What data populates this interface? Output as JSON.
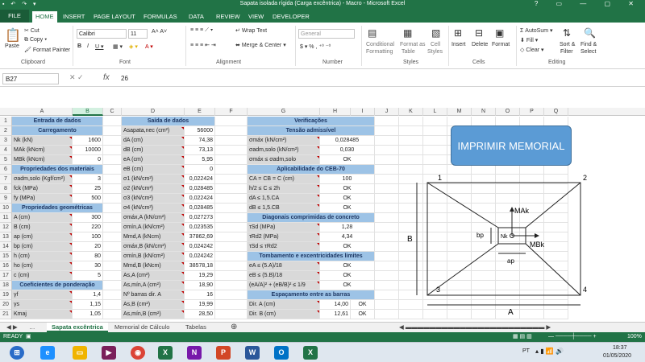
{
  "window": {
    "title": "Sapata isolada rígida (Carga excêntrica) - Macro - Microsoft Excel",
    "controls": "? ▭ — ▢ ✕"
  },
  "tabs": {
    "file": "FILE",
    "items": [
      "HOME",
      "INSERT",
      "PAGE LAYOUT",
      "FORMULAS",
      "DATA",
      "REVIEW",
      "VIEW",
      "DEVELOPER"
    ]
  },
  "ribbon": {
    "paste": "Paste",
    "cut": "Cut",
    "copy": "Copy",
    "format_painter": "Format Painter",
    "font": "Calibri",
    "size": "11",
    "wrap": "Wrap Text",
    "merge": "Merge & Center",
    "general": "General",
    "cond": "Conditional",
    "cond2": "Formatting",
    "fmt_table": "Format as",
    "fmt_table2": "Table",
    "cell_styles": "Cell",
    "cell_styles2": "Styles",
    "insert": "Insert",
    "delete": "Delete",
    "format": "Format",
    "autosum": "AutoSum",
    "fill": "Fill",
    "clear": "Clear",
    "sort": "Sort &",
    "sort2": "Filter",
    "find": "Find &",
    "find2": "Select",
    "groups": [
      "Clipboard",
      "Font",
      "Alignment",
      "Number",
      "Styles",
      "Cells",
      "Editing"
    ]
  },
  "formula_bar": {
    "name_box": "B27",
    "value": "26"
  },
  "columns": [
    "A",
    "B",
    "C",
    "D",
    "E",
    "F",
    "G",
    "H",
    "I",
    "J",
    "K",
    "L",
    "M",
    "N",
    "O",
    "P",
    "Q"
  ],
  "rows": [
    "1",
    "2",
    "3",
    "4",
    "5",
    "6",
    "7",
    "8",
    "9",
    "10",
    "11",
    "12",
    "13",
    "14",
    "15",
    "16",
    "17",
    "18",
    "19",
    "20",
    "21"
  ],
  "input": {
    "title": "Entrada de dados",
    "sections": {
      "load": "Carregamento",
      "mat": "Propriedades dos materiais",
      "geo": "Propriedades geométricas",
      "coef": "Coeficientes de ponderação"
    },
    "rows": [
      [
        "Nk (kN)",
        "1600"
      ],
      [
        "MAk (kNcm)",
        "10000"
      ],
      [
        "MBk (kNcm)",
        "0"
      ],
      [
        "σadm,solo (Kgf/cm²)",
        "3"
      ],
      [
        "fck (MPa)",
        "25"
      ],
      [
        "fy (MPa)",
        "500"
      ],
      [
        "A (cm)",
        "300"
      ],
      [
        "B (cm)",
        "220"
      ],
      [
        "ap (cm)",
        "100"
      ],
      [
        "bp (cm)",
        "20"
      ],
      [
        "h (cm)",
        "80"
      ],
      [
        "ho (cm)",
        "30"
      ],
      [
        "c (cm)",
        "5"
      ],
      [
        "γf",
        "1,4"
      ],
      [
        "γs",
        "1,15"
      ],
      [
        "Kmaj",
        "1,05"
      ]
    ]
  },
  "output": {
    "title": "Saída de dados",
    "rows": [
      [
        "Asapata,nec (cm²)",
        "56000"
      ],
      [
        "dA (cm)",
        "74,38"
      ],
      [
        "dB (cm)",
        "73,13"
      ],
      [
        "eA (cm)",
        "5,95"
      ],
      [
        "eB (cm)",
        "0"
      ],
      [
        "σ1 (kN/cm²)",
        "0,022424"
      ],
      [
        "σ2 (kN/cm²)",
        "0,028485"
      ],
      [
        "σ3 (kN/cm²)",
        "0,022424"
      ],
      [
        "σ4 (kN/cm²)",
        "0,028485"
      ],
      [
        "σmáx,A (kN/cm²)",
        "0,027273"
      ],
      [
        "σmín,A (kN/cm²)",
        "0,023535"
      ],
      [
        "Mmd,A (kNcm)",
        "37862,69"
      ],
      [
        "σmáx,B (kN/cm²)",
        "0,024242"
      ],
      [
        "σmín,B (kN/cm²)",
        "0,024242"
      ],
      [
        "Mmd,B (kNcm)",
        "38578,18"
      ],
      [
        "As,A (cm²)",
        "19,29"
      ],
      [
        "As,mín,A (cm²)",
        "18,90"
      ],
      [
        "Nº barras dir. A",
        "16"
      ],
      [
        "As,B (cm²)",
        "19,99"
      ],
      [
        "As,mín,B (cm²)",
        "28,50"
      ]
    ]
  },
  "verif": {
    "title": "Verificações",
    "s1": "Tensão admissível",
    "r1": [
      [
        "σmáx (kN/cm²)",
        "0,028485"
      ],
      [
        "σadm,solo (kN/cm²)",
        "0,030"
      ],
      [
        "σmáx ≤ σadm,solo",
        "OK"
      ]
    ],
    "s2": "Aplicabilidade do CEB-70",
    "r2": [
      [
        "CA = CB = C (cm)",
        "100"
      ],
      [
        "h/2 ≤ C ≤ 2h",
        "OK"
      ],
      [
        "dA ≤ 1,5.CA",
        "OK"
      ],
      [
        "dB ≤ 1,5.CB",
        "OK"
      ]
    ],
    "s3": "Diagonais comprimidas de concreto",
    "r3": [
      [
        "τSd (MPa)",
        "1,28"
      ],
      [
        "τRd2 (MPa)",
        "4,34"
      ],
      [
        "τSd ≤ τRd2",
        "OK"
      ]
    ],
    "s4": "Tombamento e excentricidades limites",
    "r4": [
      [
        "eA ≤ (5.A)/18",
        "OK"
      ],
      [
        "eB ≤ (5.B)/18",
        "OK"
      ],
      [
        "(eA/A)² + (eB/B)² ≤ 1/9",
        "OK"
      ]
    ],
    "s5": "Espaçamento entre as barras",
    "r5": [
      [
        "Dir. A (cm)",
        "14,00",
        "OK"
      ],
      [
        "Dir. B (cm)",
        "12,61",
        "OK"
      ]
    ]
  },
  "print_button": "IMPRIMIR MEMORIAL",
  "diagram": {
    "c1": "1",
    "c2": "2",
    "c3": "3",
    "c4": "4",
    "A": "A",
    "B": "B",
    "MAk": "MAk",
    "MBk": "MBk",
    "Nk": "Nk",
    "ap": "ap",
    "bp": "bp"
  },
  "sheets": [
    "Sapata excêntrica",
    "Memorial de Cálculo",
    "Tabelas"
  ],
  "status": {
    "ready": "READY",
    "zoom": "100%"
  },
  "taskbar": {
    "lang": "PT",
    "time": "18:37",
    "date": "01/05/2020"
  }
}
